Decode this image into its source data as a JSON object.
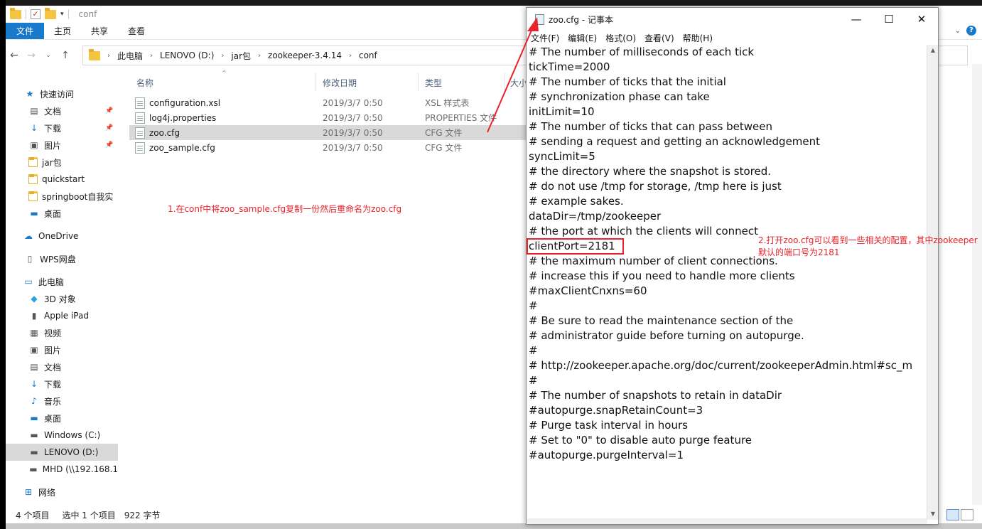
{
  "explorer": {
    "qat_title": "conf",
    "ribbon_tabs": [
      "文件",
      "主页",
      "共享",
      "查看"
    ],
    "breadcrumb": [
      "此电脑",
      "LENOVO (D:)",
      "jar包",
      "zookeeper-3.4.14",
      "conf"
    ],
    "sidebar": [
      {
        "label": "快速访问",
        "icon": "star-icon",
        "pinned": false
      },
      {
        "label": "文档",
        "icon": "document-icon",
        "pinned": true
      },
      {
        "label": "下载",
        "icon": "download-icon",
        "pinned": true
      },
      {
        "label": "图片",
        "icon": "picture-icon",
        "pinned": true
      },
      {
        "label": "jar包",
        "icon": "folder-icon",
        "pinned": false
      },
      {
        "label": "quickstart",
        "icon": "folder-icon",
        "pinned": false
      },
      {
        "label": "springboot自我实",
        "icon": "folder-icon",
        "pinned": false
      },
      {
        "label": "桌面",
        "icon": "desktop-icon",
        "pinned": false
      },
      {
        "label": "OneDrive",
        "icon": "cloud-icon",
        "pinned": false
      },
      {
        "label": "WPS网盘",
        "icon": "wps-icon",
        "pinned": false
      },
      {
        "label": "此电脑",
        "icon": "computer-icon",
        "pinned": false
      },
      {
        "label": "3D 对象",
        "icon": "cube-icon",
        "pinned": false
      },
      {
        "label": "Apple iPad",
        "icon": "ipad-icon",
        "pinned": false
      },
      {
        "label": "视频",
        "icon": "video-icon",
        "pinned": false
      },
      {
        "label": "图片",
        "icon": "picture-icon",
        "pinned": false
      },
      {
        "label": "文档",
        "icon": "document-icon",
        "pinned": false
      },
      {
        "label": "下载",
        "icon": "download-icon",
        "pinned": false
      },
      {
        "label": "音乐",
        "icon": "music-icon",
        "pinned": false
      },
      {
        "label": "桌面",
        "icon": "desktop-icon",
        "pinned": false
      },
      {
        "label": "Windows (C:)",
        "icon": "drive-icon",
        "pinned": false
      },
      {
        "label": "LENOVO (D:)",
        "icon": "drive-icon",
        "pinned": false,
        "selected": true
      },
      {
        "label": "MHD (\\\\192.168.1",
        "icon": "network-drive-icon",
        "pinned": false
      },
      {
        "label": "网络",
        "icon": "network-icon",
        "pinned": false
      }
    ],
    "columns": {
      "name": "名称",
      "date": "修改日期",
      "type": "类型",
      "size": "大小"
    },
    "files": [
      {
        "name": "configuration.xsl",
        "date": "2019/3/7 0:50",
        "type": "XSL 样式表"
      },
      {
        "name": "log4j.properties",
        "date": "2019/3/7 0:50",
        "type": "PROPERTIES 文件"
      },
      {
        "name": "zoo.cfg",
        "date": "2019/3/7 0:50",
        "type": "CFG 文件",
        "selected": true
      },
      {
        "name": "zoo_sample.cfg",
        "date": "2019/3/7 0:50",
        "type": "CFG 文件"
      }
    ],
    "status": {
      "count": "4 个项目",
      "selection": "选中 1 个项目",
      "size": "922 字节"
    }
  },
  "annotations": {
    "note1": "1.在conf中将zoo_sample.cfg复制一份然后重命名为zoo.cfg",
    "note2_line1": "2.打开zoo.cfg可以看到一些相关的配置，其中zookeeper",
    "note2_line2": "默认的端口号为2181",
    "color": "#e8232a"
  },
  "notepad": {
    "title": "zoo.cfg - 记事本",
    "menu": [
      "文件(F)",
      "编辑(E)",
      "格式(O)",
      "查看(V)",
      "帮助(H)"
    ],
    "lines": [
      "# The number of milliseconds of each tick",
      "tickTime=2000",
      "# The number of ticks that the initial",
      "# synchronization phase can take",
      "initLimit=10",
      "# The number of ticks that can pass between",
      "# sending a request and getting an acknowledgement",
      "syncLimit=5",
      "# the directory where the snapshot is stored.",
      "# do not use /tmp for storage, /tmp here is just",
      "# example sakes.",
      "dataDir=/tmp/zookeeper",
      "# the port at which the clients will connect",
      "clientPort=2181",
      "# the maximum number of client connections.",
      "# increase this if you need to handle more clients",
      "#maxClientCnxns=60",
      "#",
      "# Be sure to read the maintenance section of the",
      "# administrator guide before turning on autopurge.",
      "#",
      "# http://zookeeper.apache.org/doc/current/zookeeperAdmin.html#sc_m",
      "#",
      "# The number of snapshots to retain in dataDir",
      "#autopurge.snapRetainCount=3",
      "# Purge task interval in hours",
      "# Set to \"0\" to disable auto purge feature",
      "#autopurge.purgeInterval=1"
    ]
  }
}
